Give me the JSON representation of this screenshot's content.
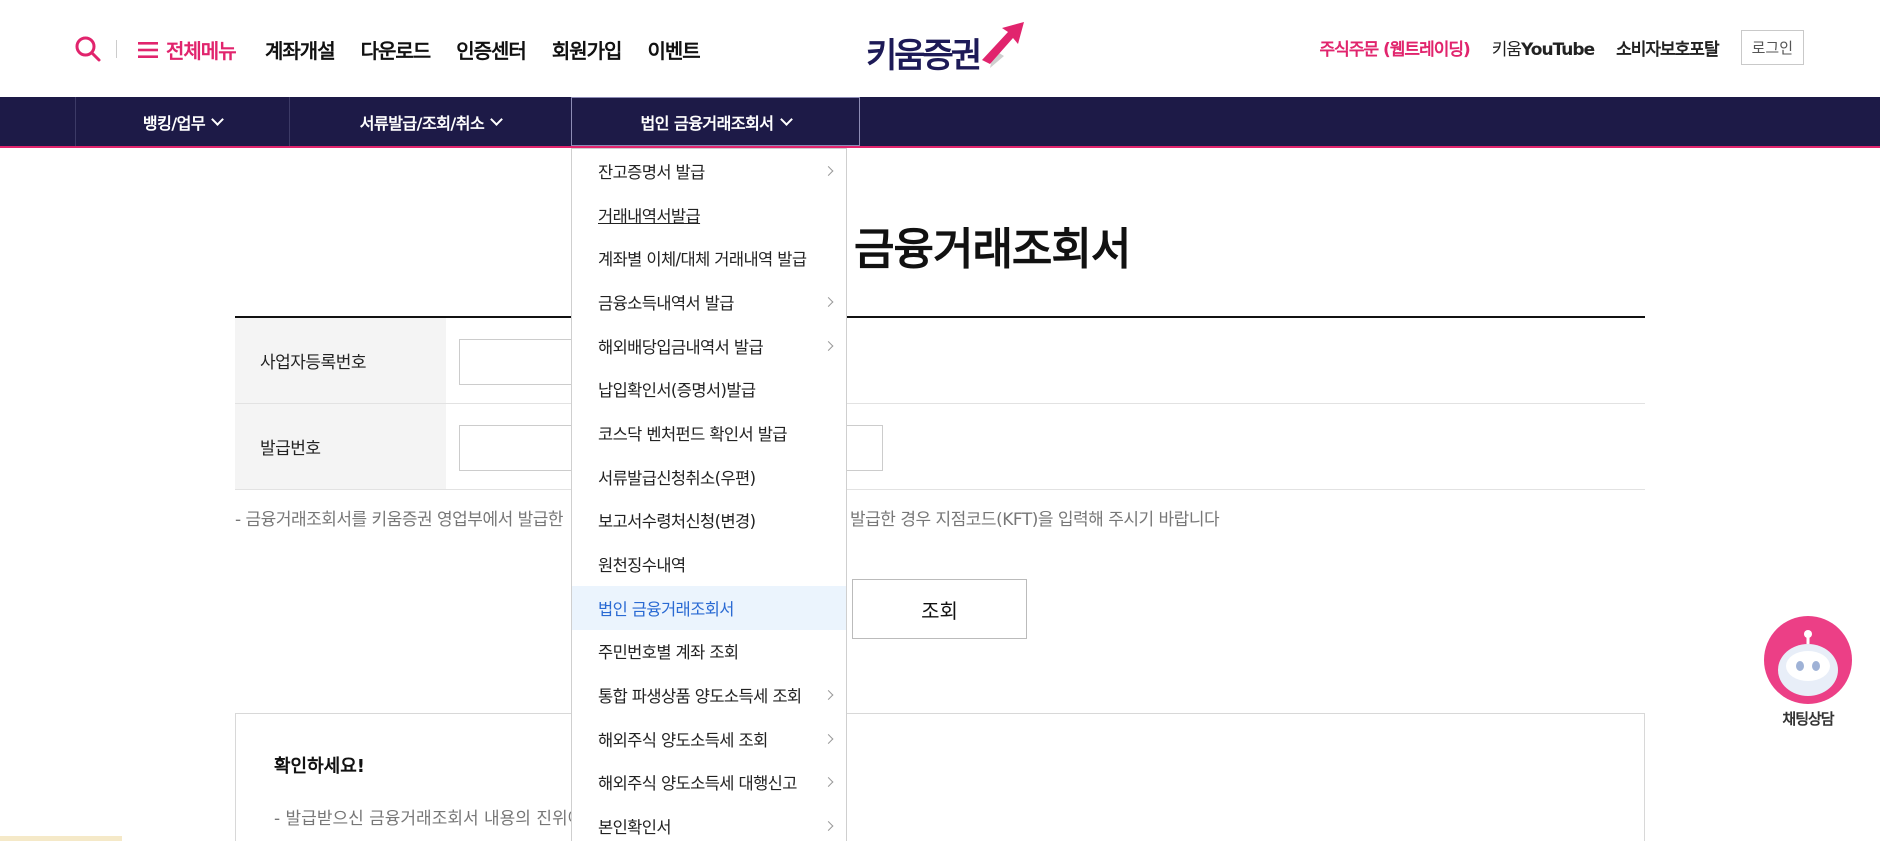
{
  "header": {
    "all_menu_label": "전체메뉴",
    "nav": [
      "계좌개설",
      "다운로드",
      "인증센터",
      "회원가입",
      "이벤트"
    ],
    "logo_text": "키움증권",
    "order_link": "주식주문 (웹트레이딩)",
    "youtube_prefix": "키움",
    "youtube_brand": "YouTube",
    "consumer_portal": "소비자보호포탈",
    "login": "로그인"
  },
  "subnav": {
    "items": [
      "뱅킹/업무",
      "서류발급/조회/취소",
      "법인 금융거래조회서"
    ]
  },
  "page": {
    "title": "금융거래조회서",
    "fields": [
      {
        "label": "사업자등록번호"
      },
      {
        "label": "발급번호"
      }
    ],
    "notice_a": "- 금융거래조회서를 키움증권 영업부에서 발급한",
    "notice_b": "발급한 경우 지점코드(KFT)을 입력해 주시기 바랍니다",
    "submit": "조회",
    "info_title": "확인하세요!",
    "info_line": "- 발급받으신 금융거래조회서 내용의 진위여"
  },
  "dropdown": {
    "items": [
      {
        "label": "잔고증명서 발급",
        "has_sub": true
      },
      {
        "label": "거래내역서발급",
        "has_sub": false,
        "underline": true
      },
      {
        "label": "계좌별 이체/대체 거래내역 발급",
        "has_sub": false
      },
      {
        "label": "금융소득내역서 발급",
        "has_sub": true
      },
      {
        "label": "해외배당입금내역서 발급",
        "has_sub": true
      },
      {
        "label": "납입확인서(증명서)발급",
        "has_sub": false
      },
      {
        "label": "코스닥 벤처펀드 확인서 발급",
        "has_sub": false
      },
      {
        "label": "서류발급신청취소(우편)",
        "has_sub": false
      },
      {
        "label": "보고서수령처신청(변경)",
        "has_sub": false
      },
      {
        "label": "원천징수내역",
        "has_sub": false
      },
      {
        "label": "법인 금융거래조회서",
        "has_sub": false,
        "active": true
      },
      {
        "label": "주민번호별 계좌 조회",
        "has_sub": false
      },
      {
        "label": "통합 파생상품 양도소득세 조회",
        "has_sub": true
      },
      {
        "label": "해외주식 양도소득세 조회",
        "has_sub": true
      },
      {
        "label": "해외주식 양도소득세 대행신고",
        "has_sub": true
      },
      {
        "label": "본인확인서",
        "has_sub": true
      }
    ]
  },
  "chatbot": {
    "label": "채팅상담"
  },
  "colors": {
    "brand_pink": "#e1246d",
    "navy": "#1d1a47",
    "active_blue": "#2a6ad3"
  }
}
